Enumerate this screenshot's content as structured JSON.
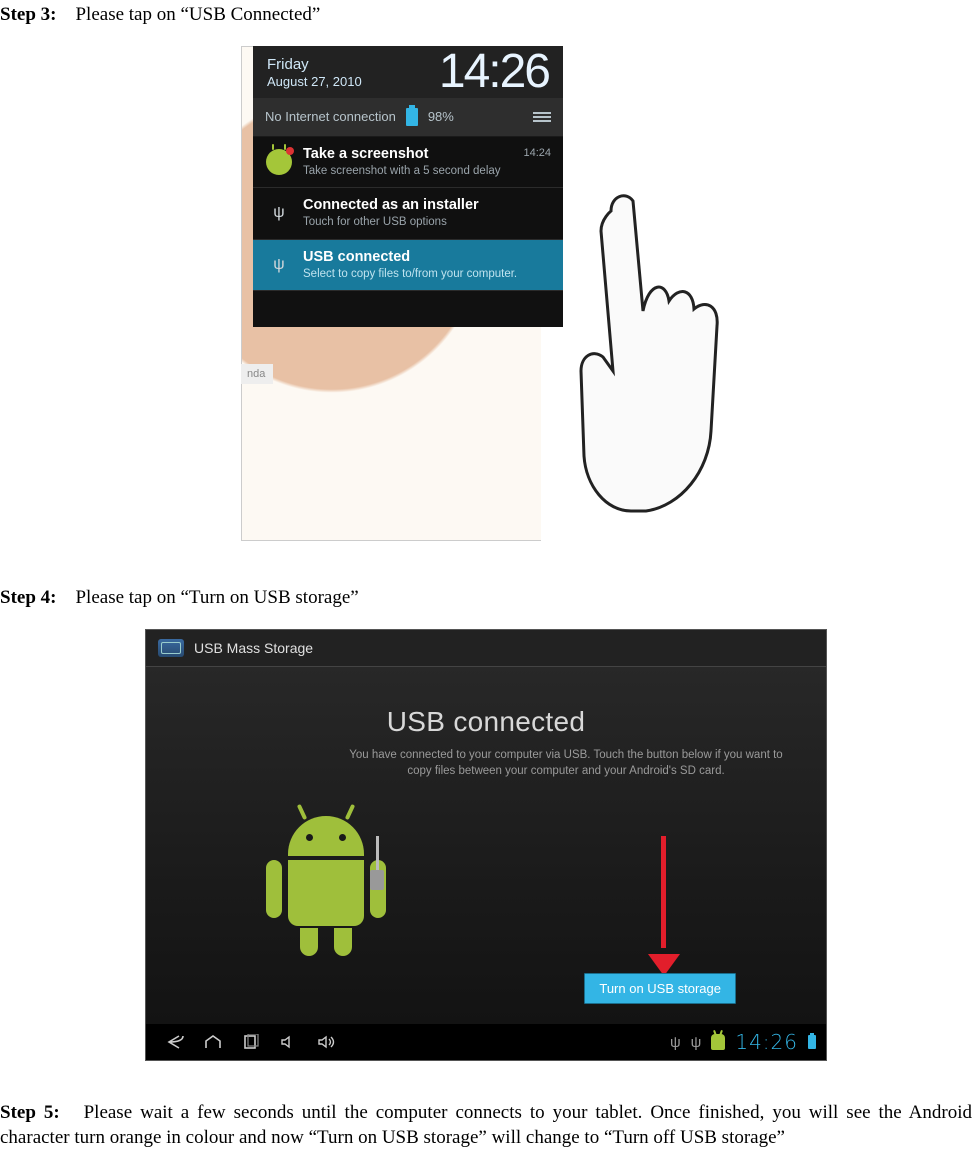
{
  "steps": {
    "s3": {
      "label": "Step 3:",
      "text": "Please tap on “USB Connected”"
    },
    "s4": {
      "label": "Step 4:",
      "text": "Please tap on “Turn on USB storage”"
    },
    "s5": {
      "label": "Step 5:",
      "text": "Please wait a few seconds until the computer connects to your tablet.   Once finished, you will see the Android character turn orange in colour and now “Turn on USB storage” will change to “Turn off USB storage”"
    }
  },
  "shade": {
    "day": "Friday",
    "date": "August 27, 2010",
    "big_time": "14:26",
    "no_net": "No Internet connection",
    "battery": "98%",
    "notifications": [
      {
        "title": "Take a screenshot",
        "subtitle": "Take screenshot with a 5 second delay",
        "time": "14:24",
        "icon": "android-bug"
      },
      {
        "title": "Connected as an installer",
        "subtitle": "Touch for other USB options",
        "icon": "usb"
      },
      {
        "title": "USB connected",
        "subtitle": "Select to copy files to/from your computer.",
        "icon": "usb",
        "selected": true
      }
    ],
    "bg_partial_text": "nda"
  },
  "usb_screen": {
    "titlebar": "USB Mass Storage",
    "heading": "USB connected",
    "description": "You have connected to your computer via USB. Touch the button below if you want to copy files between your computer and your Android's SD card.",
    "button": "Turn on USB storage",
    "clock": "14:26"
  }
}
